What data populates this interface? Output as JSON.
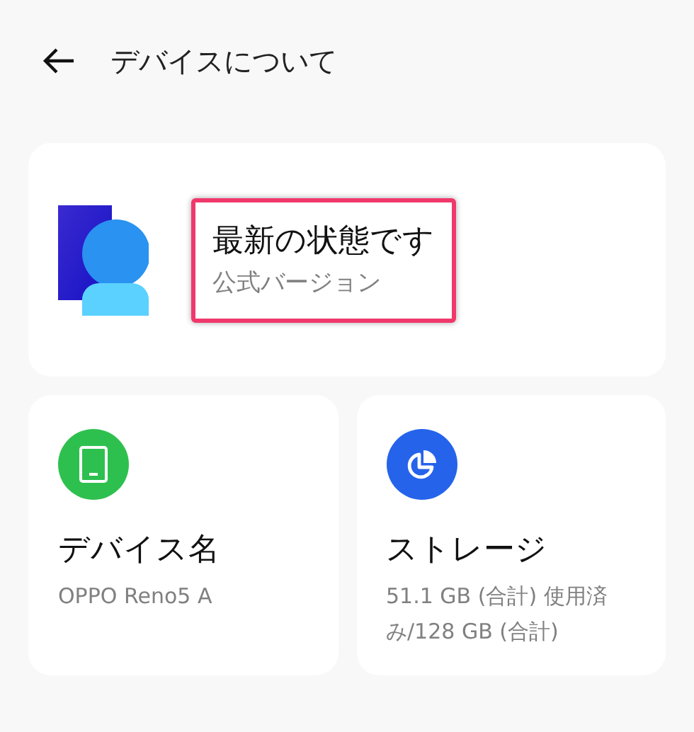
{
  "header": {
    "title": "デバイスについて"
  },
  "update_card": {
    "status": "最新の状態です",
    "version": "公式バージョン",
    "highlighted": true
  },
  "info_cards": [
    {
      "kind": "device",
      "title": "デバイス名",
      "value": "OPPO Reno5 A"
    },
    {
      "kind": "storage",
      "title": "ストレージ",
      "value": "51.1 GB (合計) 使用済み/128 GB (合計)"
    }
  ]
}
